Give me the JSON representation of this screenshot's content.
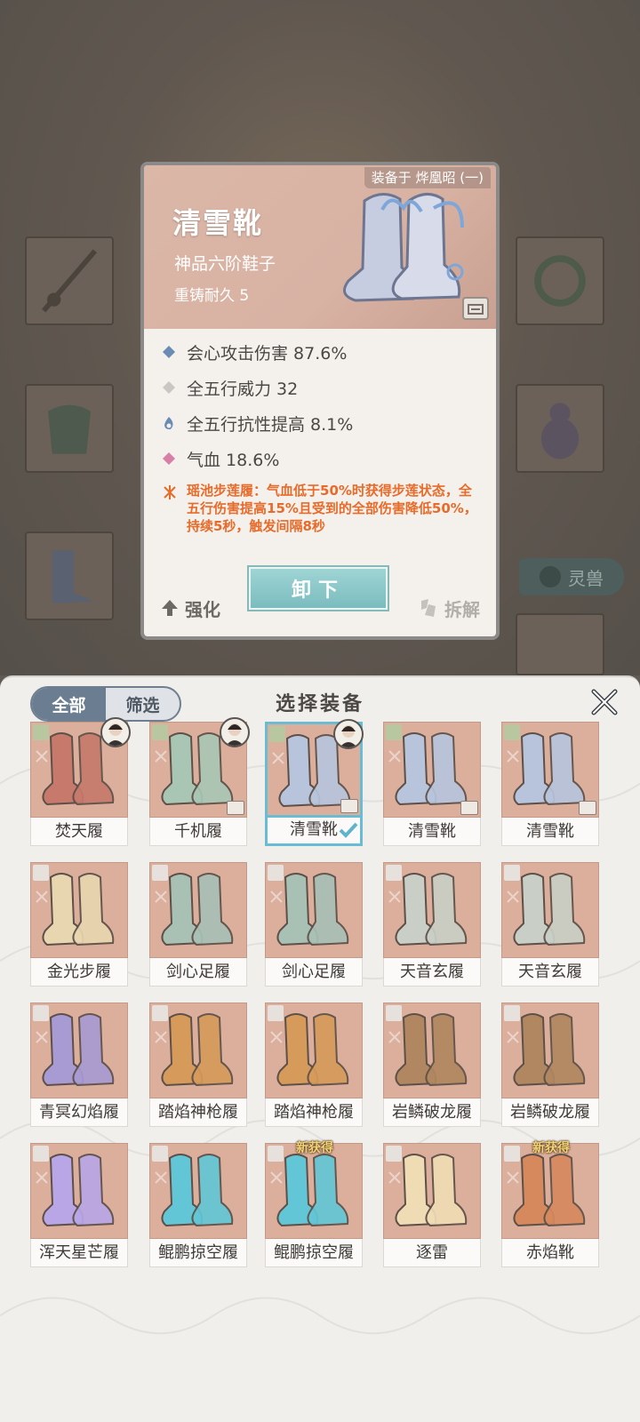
{
  "background": {
    "side_tab_label": "灵兽"
  },
  "detail": {
    "equipped_on": "装备于 烨凰昭 (一)",
    "name": "清雪靴",
    "grade": "神品六阶鞋子",
    "reforge": "重铸耐久 5",
    "stats": [
      {
        "icon": "diamond-blue-icon",
        "text": "会心攻击伤害 87.6%"
      },
      {
        "icon": "diamond-gray-icon",
        "text": "全五行威力 32"
      },
      {
        "icon": "flame-blue-icon",
        "text": "全五行抗性提高 8.1%"
      },
      {
        "icon": "diamond-pink-icon",
        "text": "气血 18.6%"
      }
    ],
    "skill_text": "瑶池步莲履：气血低于50%时获得步莲状态，全五行伤害提高15%且受到的全部伤害降低50%，持续5秒，触发间隔8秒",
    "btn_enhance": "强化",
    "btn_unequip": "卸下",
    "btn_dismantle": "拆解"
  },
  "panel": {
    "title": "选择装备",
    "filter_all": "全部",
    "filter_screen": "筛选",
    "items": [
      {
        "name": "焚天履",
        "color": "#c77a6c",
        "avatar": true,
        "lock": false,
        "new": "",
        "selected": false
      },
      {
        "name": "千机履",
        "color": "#a8c6b3",
        "avatar": true,
        "lock": true,
        "new": "",
        "selected": false
      },
      {
        "name": "清雪靴",
        "color": "#b8c4dc",
        "avatar": true,
        "lock": true,
        "new": "",
        "selected": true
      },
      {
        "name": "清雪靴",
        "color": "#b8c4dc",
        "avatar": false,
        "lock": true,
        "new": "",
        "selected": false
      },
      {
        "name": "清雪靴",
        "color": "#b8c4dc",
        "avatar": false,
        "lock": true,
        "new": "",
        "selected": false
      },
      {
        "name": "金光步履",
        "color": "#e8d6b0",
        "avatar": false,
        "lock": false,
        "new": "",
        "selected": false
      },
      {
        "name": "剑心足履",
        "color": "#a9c0b5",
        "avatar": false,
        "lock": false,
        "new": "",
        "selected": false
      },
      {
        "name": "剑心足履",
        "color": "#a9c0b5",
        "avatar": false,
        "lock": false,
        "new": "",
        "selected": false
      },
      {
        "name": "天音玄履",
        "color": "#c9cfc6",
        "avatar": false,
        "lock": false,
        "new": "",
        "selected": false
      },
      {
        "name": "天音玄履",
        "color": "#c9cfc6",
        "avatar": false,
        "lock": false,
        "new": "",
        "selected": false
      },
      {
        "name": "青冥幻焰履",
        "color": "#a89ad2",
        "avatar": false,
        "lock": false,
        "new": "",
        "selected": false
      },
      {
        "name": "踏焰神枪履",
        "color": "#d69a5a",
        "avatar": false,
        "lock": false,
        "new": "",
        "selected": false
      },
      {
        "name": "踏焰神枪履",
        "color": "#d69a5a",
        "avatar": false,
        "lock": false,
        "new": "",
        "selected": false
      },
      {
        "name": "岩鳞破龙履",
        "color": "#b08760",
        "avatar": false,
        "lock": false,
        "new": "",
        "selected": false
      },
      {
        "name": "岩鳞破龙履",
        "color": "#b08760",
        "avatar": false,
        "lock": false,
        "new": "",
        "selected": false
      },
      {
        "name": "浑天星芒履",
        "color": "#b9a6e6",
        "avatar": false,
        "lock": false,
        "new": "",
        "selected": false
      },
      {
        "name": "鲲鹏掠空履",
        "color": "#63c6d6",
        "avatar": false,
        "lock": false,
        "new": "",
        "selected": false
      },
      {
        "name": "鲲鹏掠空履",
        "color": "#63c6d6",
        "avatar": false,
        "lock": false,
        "new": "新获得",
        "selected": false
      },
      {
        "name": "逐雷",
        "color": "#f0dcb4",
        "avatar": false,
        "lock": false,
        "new": "",
        "selected": false
      },
      {
        "name": "赤焰靴",
        "color": "#d7895e",
        "avatar": false,
        "lock": false,
        "new": "新获得",
        "selected": false
      }
    ]
  }
}
